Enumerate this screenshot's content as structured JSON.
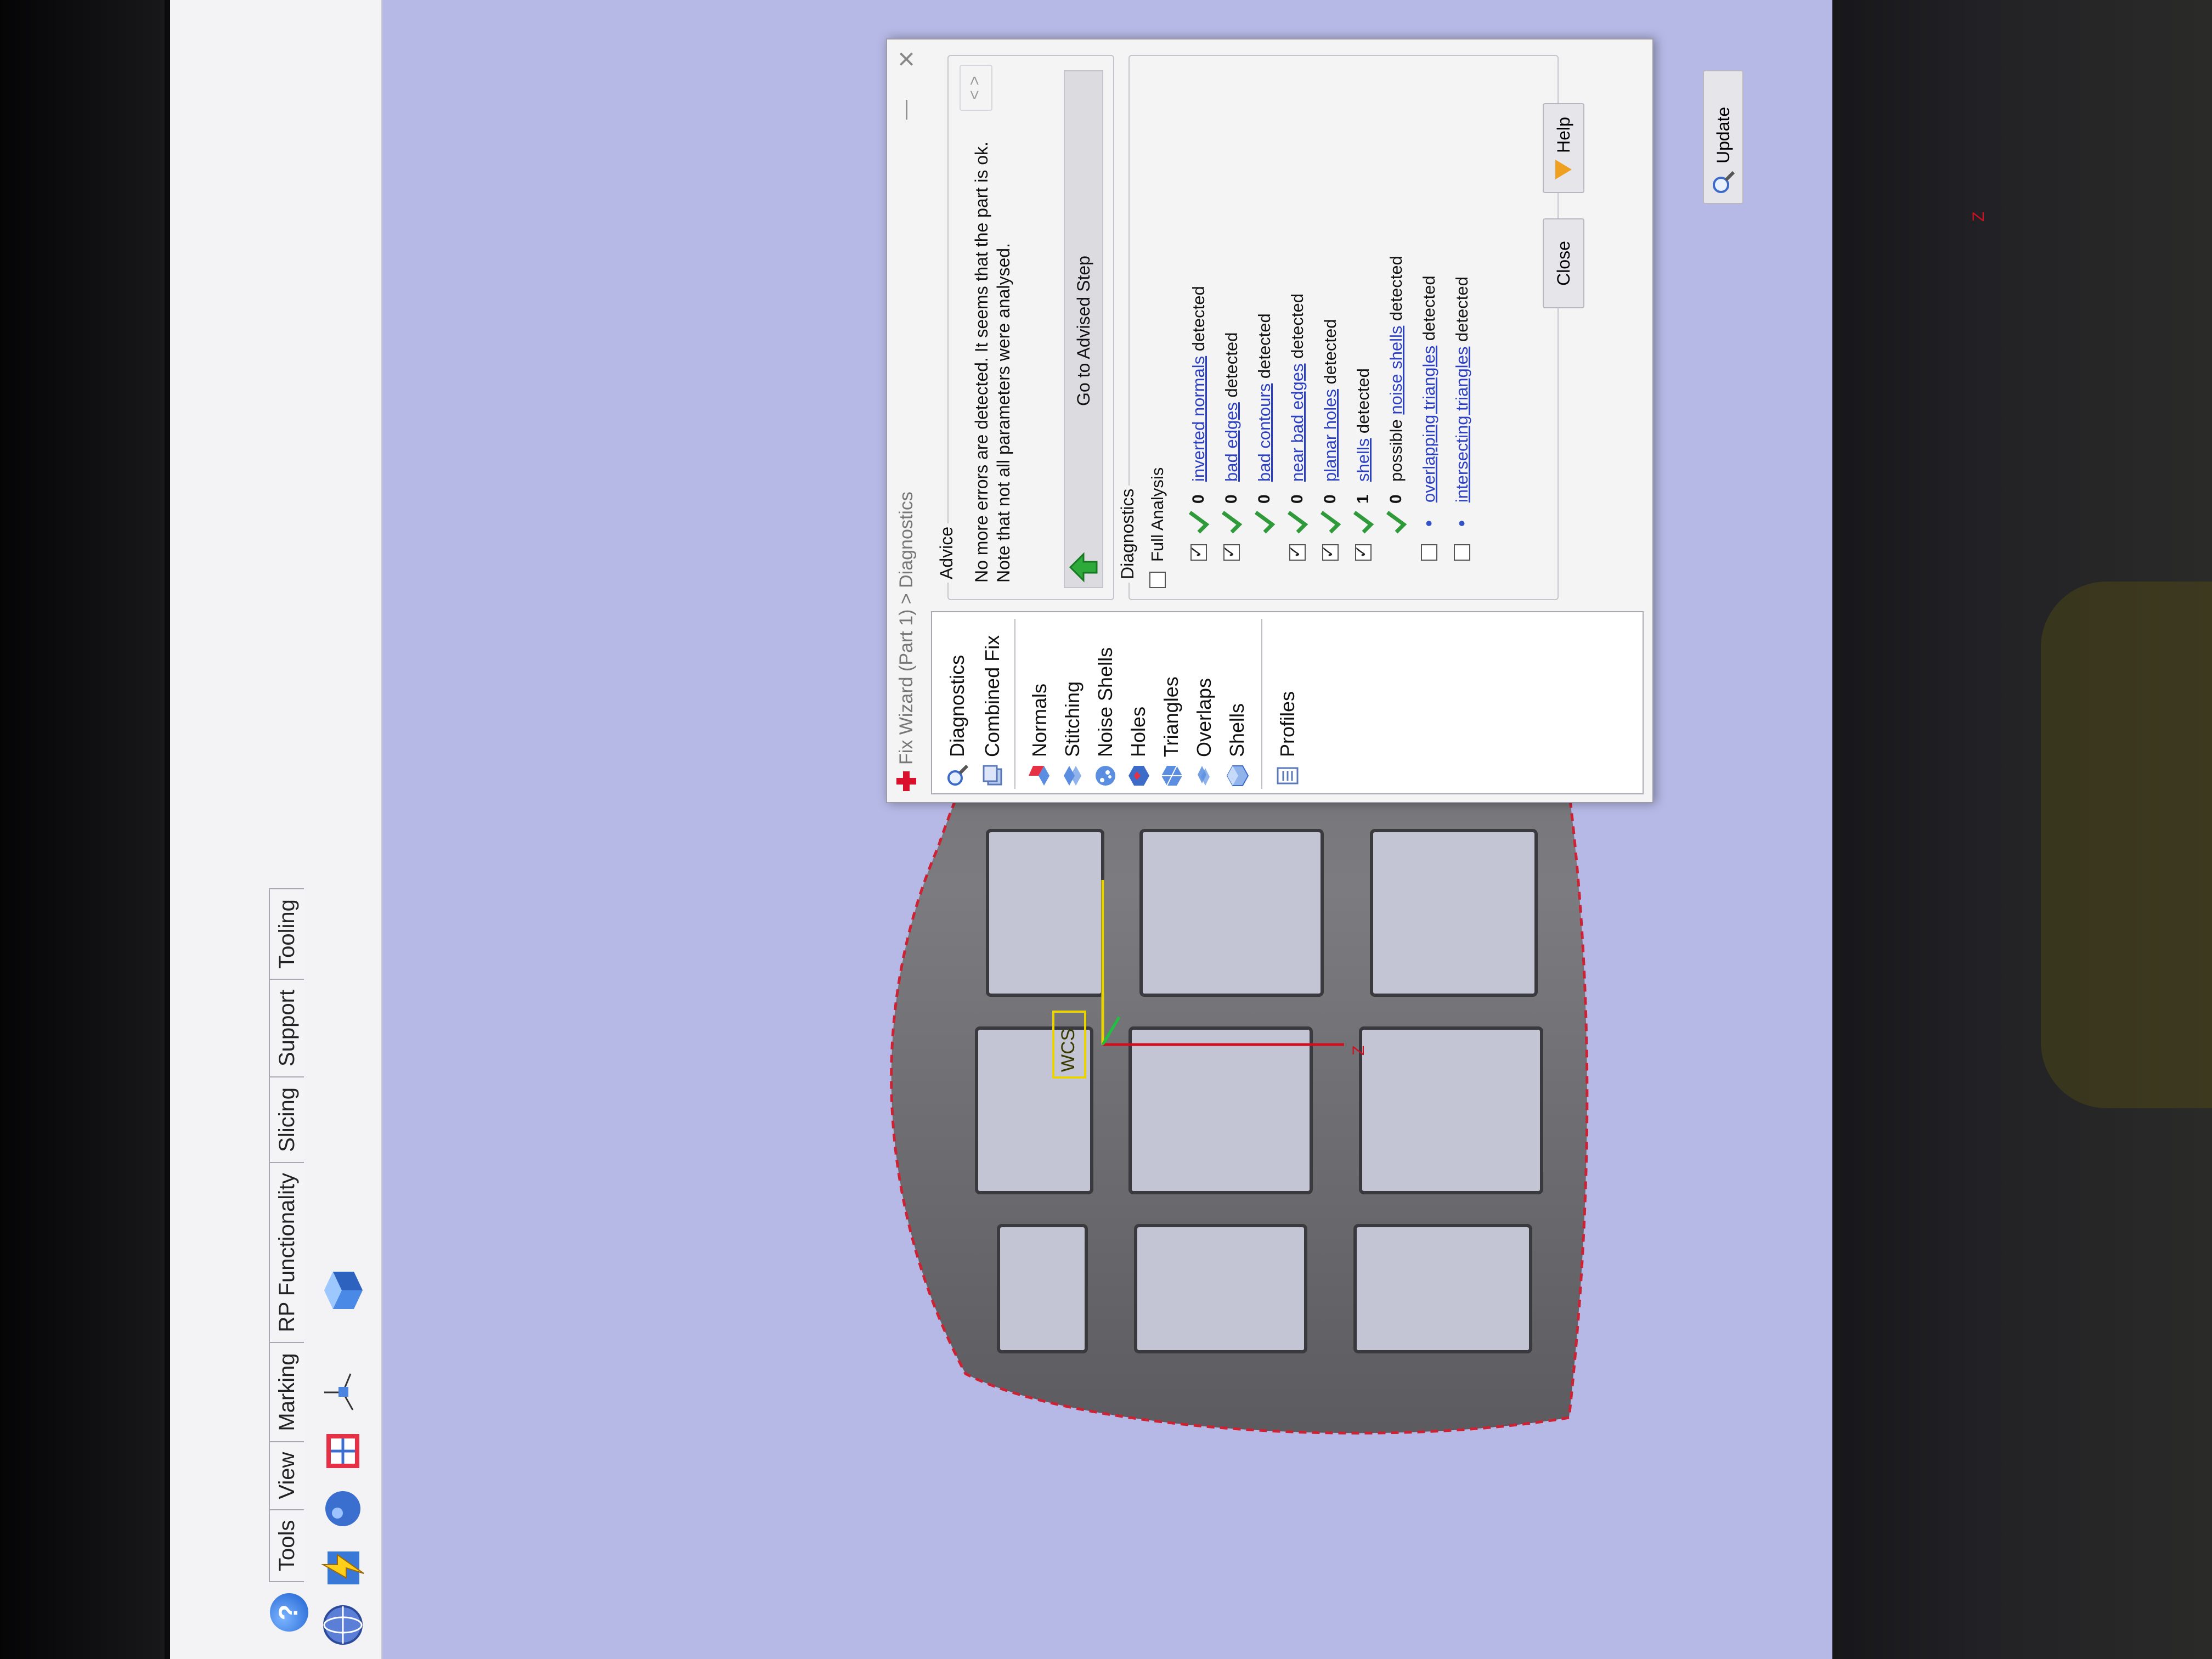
{
  "app": {
    "tabs": [
      {
        "label": "Tools"
      },
      {
        "label": "View"
      },
      {
        "label": "Marking"
      },
      {
        "label": "RP Functionality"
      },
      {
        "label": "Slicing"
      },
      {
        "label": "Support"
      },
      {
        "label": "Tooling"
      }
    ],
    "toolbar_icons": [
      "help-icon",
      "sphere-icon",
      "lightning-icon",
      "axes-icon",
      "box-icon"
    ]
  },
  "viewport": {
    "origin_label": "WCS",
    "axis_labels": {
      "z": "Z",
      "x": "X"
    }
  },
  "dialog": {
    "title": "Fix Wizard (Part 1) > Diagnostics",
    "close_glyph": "×",
    "minimize_glyph": "—",
    "nav": {
      "top_items": [
        {
          "label": "Diagnostics",
          "icon": "magnifier-icon"
        },
        {
          "label": "Combined Fix",
          "icon": "stack-icon"
        }
      ],
      "fix_items": [
        {
          "label": "Normals",
          "icon": "normals-icon"
        },
        {
          "label": "Stitching",
          "icon": "stitching-icon"
        },
        {
          "label": "Noise Shells",
          "icon": "noise-shells-icon"
        },
        {
          "label": "Holes",
          "icon": "holes-icon"
        },
        {
          "label": "Triangles",
          "icon": "triangles-icon"
        },
        {
          "label": "Overlaps",
          "icon": "overlaps-icon"
        },
        {
          "label": "Shells",
          "icon": "shells-icon"
        }
      ],
      "bottom_items": [
        {
          "label": "Profiles",
          "icon": "profiles-icon"
        }
      ]
    },
    "advice": {
      "group_label": "Advice",
      "text": "No more errors are detected. It seems that the part is ok. Note that not all parameters were analysed.",
      "pager": "< >",
      "advised_step_label": "Go to Advised Step"
    },
    "diagnostics": {
      "group_label": "Diagnostics",
      "full_analysis_label": "Full Analysis",
      "full_analysis_checked": false,
      "rows": [
        {
          "checked": true,
          "status": "ok",
          "count": "0",
          "prefix": "",
          "link": "inverted normals",
          "suffix": " detected"
        },
        {
          "checked": true,
          "status": "ok",
          "count": "0",
          "prefix": "",
          "link": "bad edges",
          "suffix": " detected"
        },
        {
          "checked": null,
          "status": "ok",
          "count": "0",
          "prefix": "",
          "link": "bad contours",
          "suffix": " detected"
        },
        {
          "checked": true,
          "status": "ok",
          "count": "0",
          "prefix": "",
          "link": "near bad edges",
          "suffix": " detected"
        },
        {
          "checked": true,
          "status": "ok",
          "count": "0",
          "prefix": "",
          "link": "planar holes",
          "suffix": " detected"
        },
        {
          "checked": true,
          "status": "ok",
          "count": "1",
          "prefix": "",
          "link": "shells",
          "suffix": " detected"
        },
        {
          "checked": null,
          "status": "ok",
          "count": "0",
          "prefix": "possible ",
          "link": "noise shells",
          "suffix": " detected"
        },
        {
          "checked": false,
          "status": "none",
          "count": "•",
          "prefix": "",
          "link": "overlapping triangles",
          "suffix": " detected"
        },
        {
          "checked": false,
          "status": "none",
          "count": "•",
          "prefix": "",
          "link": "intersecting triangles",
          "suffix": " detected"
        }
      ]
    },
    "buttons": {
      "update": "Update",
      "close": "Close",
      "help": "Help"
    }
  },
  "colors": {
    "viewport_bg": "#b6b9e6",
    "model_gray": "#6e6e72",
    "ok_green": "#2e9a3a",
    "link_blue": "#2b3fc4",
    "brand_red": "#d9112a"
  }
}
